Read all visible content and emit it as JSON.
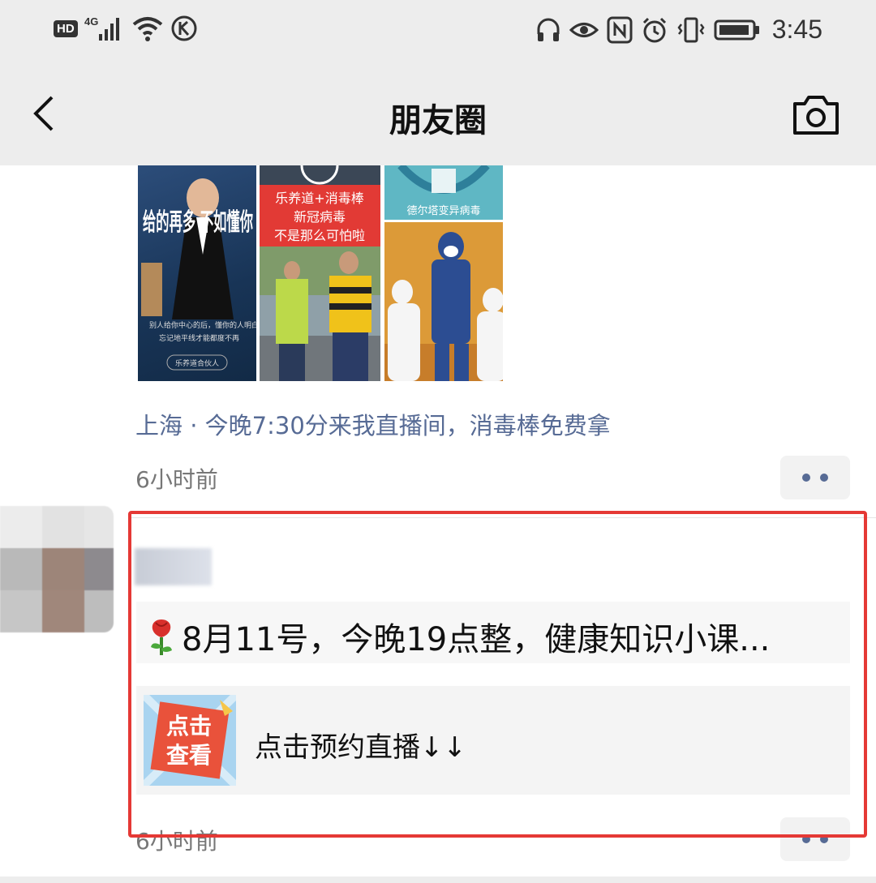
{
  "status_bar": {
    "hd_badge": "HD",
    "network_label": "4G",
    "time": "3:45",
    "icons": [
      "signal-icon",
      "wifi-icon",
      "k-app-icon",
      "headphones-icon",
      "eye-icon",
      "nfc-icon",
      "alarm-icon",
      "vibrate-icon",
      "battery-icon"
    ]
  },
  "nav": {
    "title": "朋友圈",
    "back_icon": "chevron-left-icon",
    "camera_icon": "camera-icon"
  },
  "post1": {
    "images": [
      {
        "headline": "给的再多 不如懂你",
        "caption1": "别人给你中心的后，懂你的人明白",
        "caption2": "忘记地平线才能都度不再",
        "footer": "乐养道合伙人"
      },
      {
        "banner1": "乐养道+消毒棒",
        "banner2": "新冠病毒",
        "banner3": "不是那么可怕啦"
      },
      {
        "banner": "德尔塔变异病毒"
      }
    ],
    "location_line": "上海 · 今晚7:30分来我直播间，消毒棒免费拿",
    "time": "6小时前"
  },
  "post2": {
    "emoji": "rose-icon",
    "text": "8月11号，今晚19点整，健康知识小课...",
    "link_thumb_lines": [
      "点击",
      "查看"
    ],
    "link_title": "点击预约直播↓↓",
    "time": "6小时前"
  },
  "colors": {
    "bar_bg": "#ededed",
    "link_blue": "#576b95",
    "highlight": "#e53935",
    "thumb_orange": "#f36b3a"
  }
}
